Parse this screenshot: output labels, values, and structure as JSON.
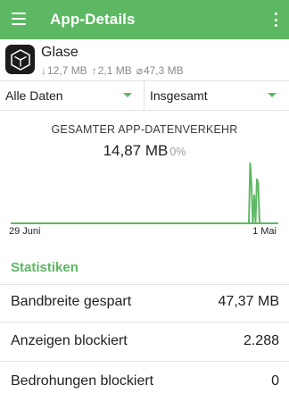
{
  "appbar": {
    "title": "App-Details"
  },
  "app": {
    "name": "Glase",
    "icon_name": "glase-app-icon",
    "total_download": "12,7 MB",
    "total_upload": "2,1 MB",
    "average": "47,3 MB"
  },
  "filters": {
    "data_type": "Alle Daten",
    "period": "Insgesamt"
  },
  "chart": {
    "title": "GESAMTER APP-DATENVERKEHR",
    "total": "14,87 MB",
    "percent": "0%",
    "x_start_label": "29 Juni",
    "x_end_label": "1 Mai"
  },
  "chart_data": {
    "type": "line",
    "title": "GESAMTER APP-DATENVERKEHR",
    "x_tick_labels": [
      "29 Juni",
      "1 Mai"
    ],
    "x": [
      0,
      0.87,
      0.88,
      0.885,
      0.89,
      0.895,
      0.9,
      0.905,
      0.91,
      0.915,
      0.92,
      0.925,
      0.93,
      0.935,
      0.94,
      1
    ],
    "series": [
      {
        "values": [
          0,
          0,
          0,
          0,
          0,
          0.82,
          0.52,
          0,
          0.38,
          0.02,
          0.6,
          0.55,
          0,
          0,
          0,
          0
        ]
      }
    ],
    "xlabel": "",
    "ylabel": "",
    "grid": false,
    "color": "#5db863"
  },
  "statistics": {
    "header": "Statistiken",
    "rows": [
      {
        "label": "Bandbreite gespart",
        "value": "47,37 MB"
      },
      {
        "label": "Anzeigen blockiert",
        "value": "2.288"
      },
      {
        "label": "Bedrohungen blockiert",
        "value": "0"
      }
    ]
  },
  "colors": {
    "accent": "#5db863",
    "text": "#212121",
    "muted": "#8a8a8a"
  }
}
